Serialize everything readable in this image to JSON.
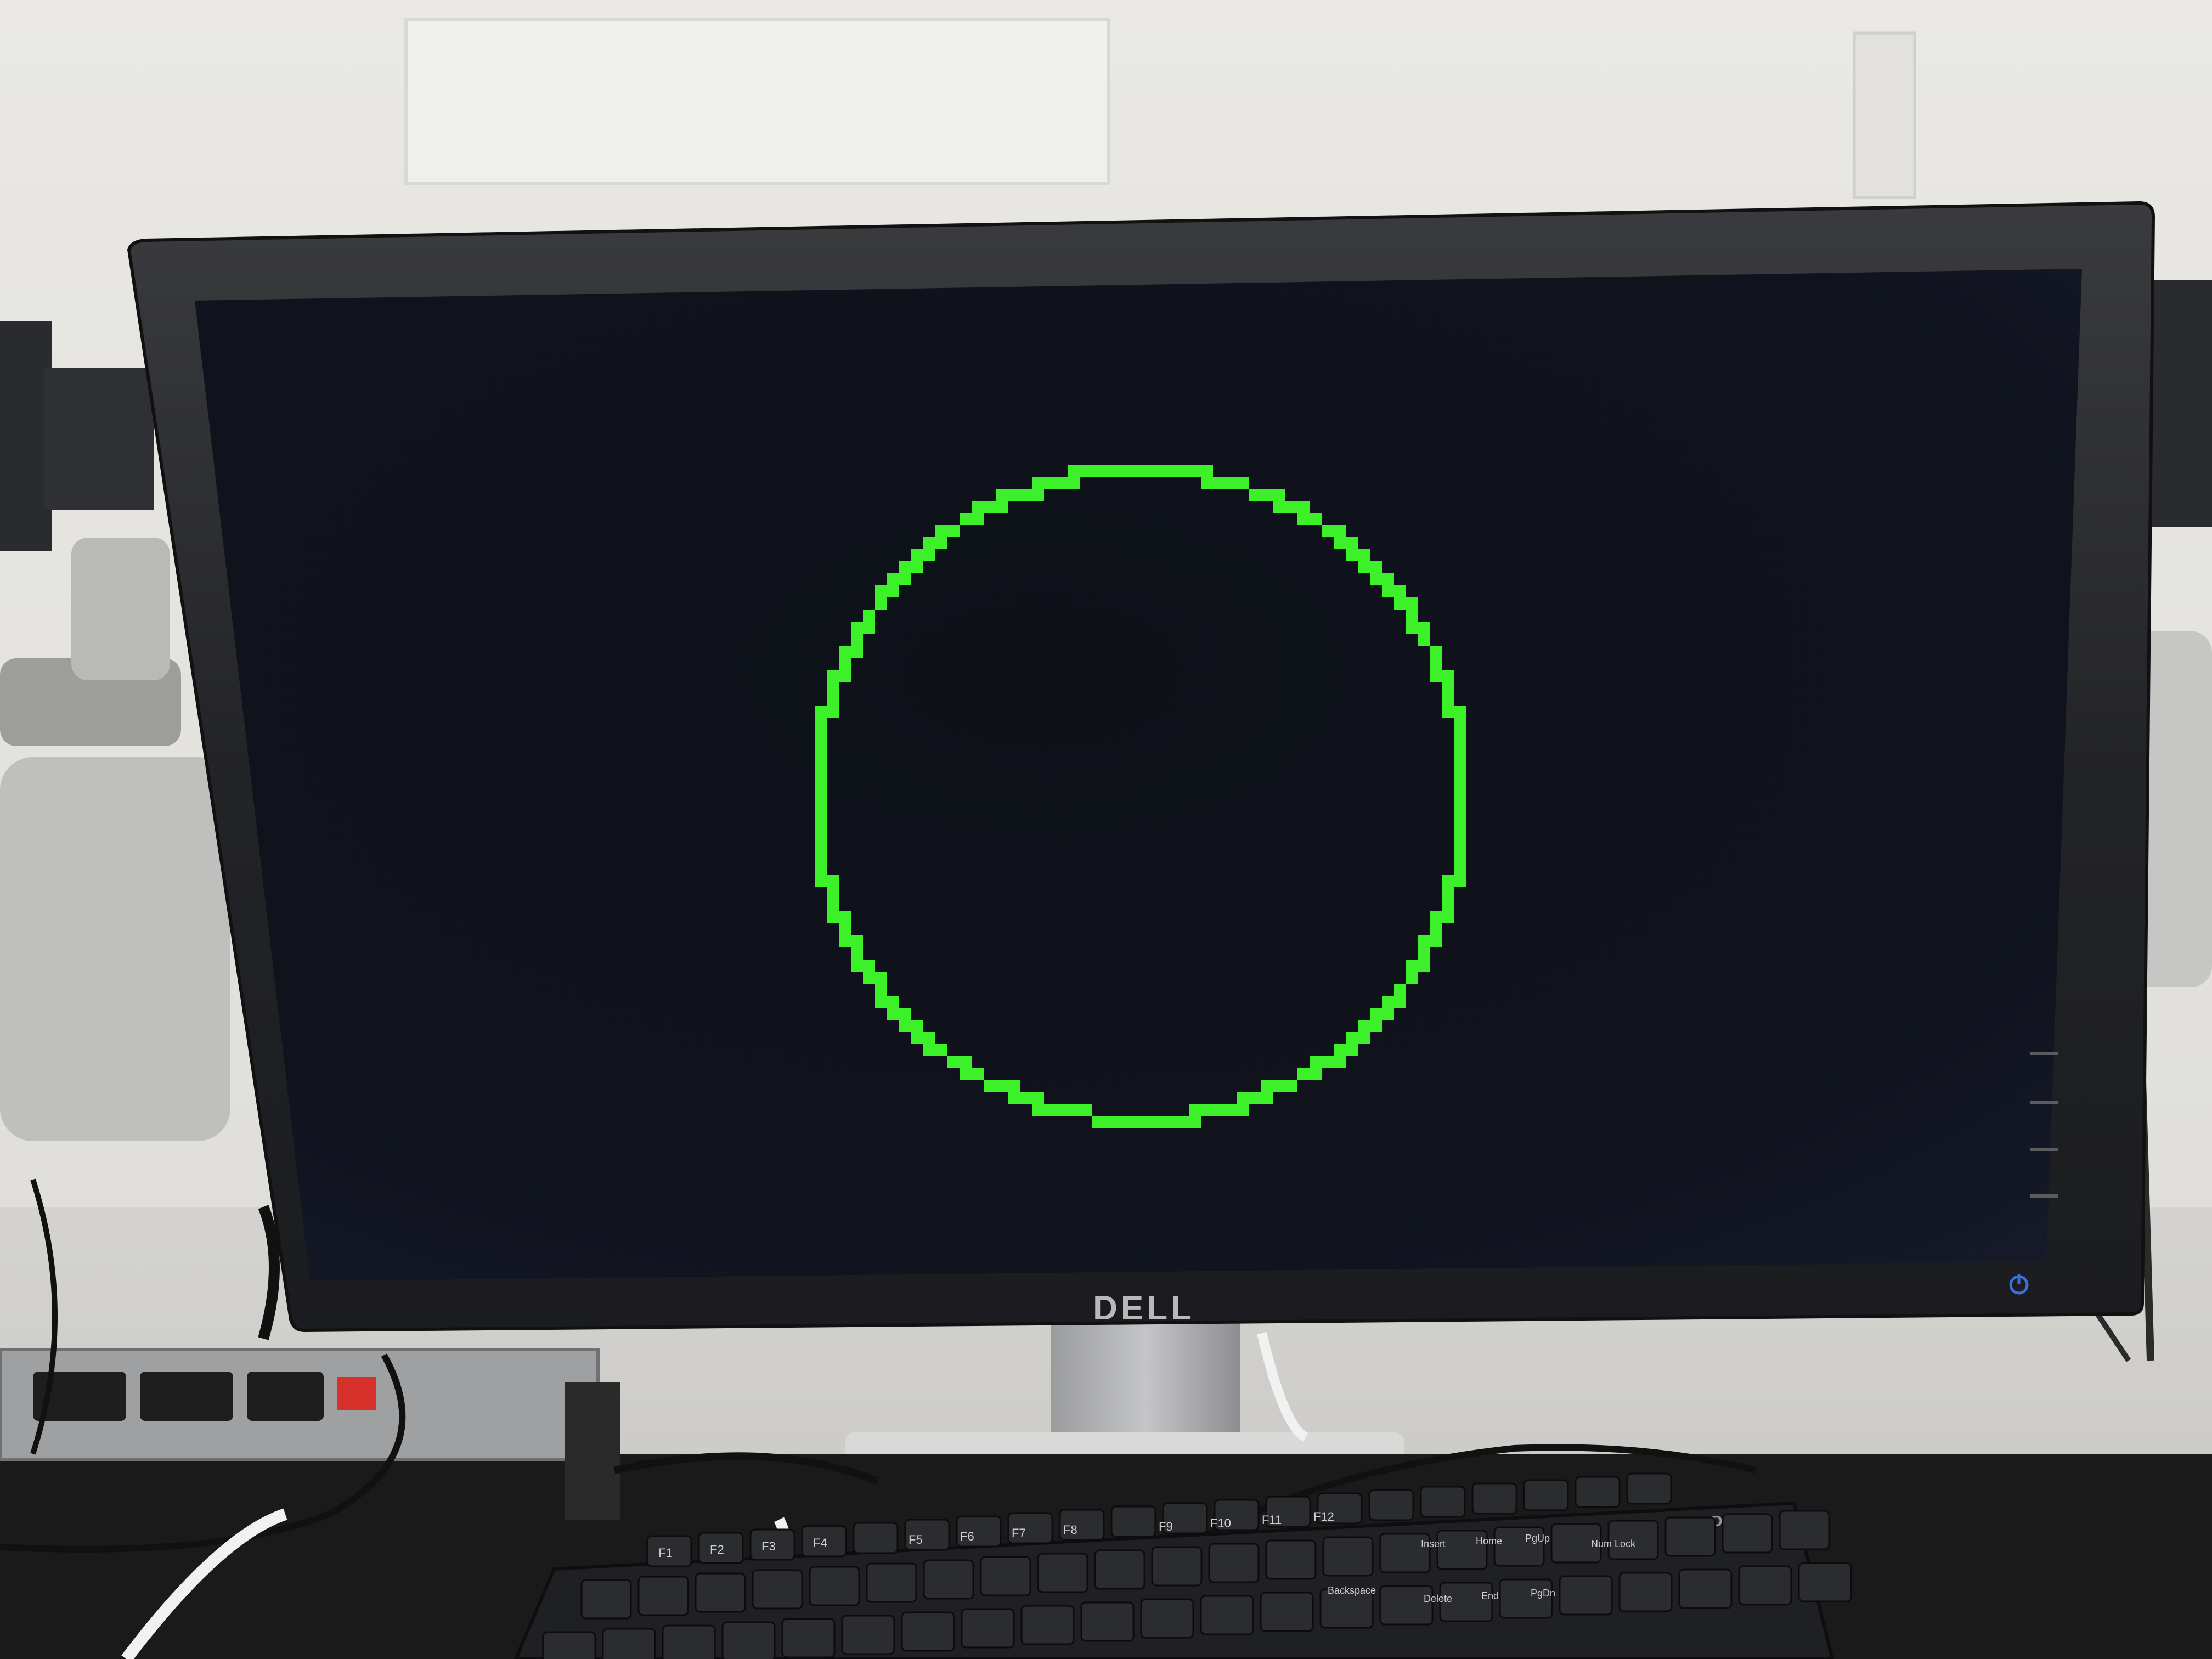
{
  "monitor": {
    "brand": "DELL"
  },
  "screen": {
    "background": "#0b0e14",
    "circle_color": "#3cf02a"
  },
  "keyboard": {
    "brand": "DELL",
    "function_keys": [
      "F1",
      "F2",
      "F3",
      "F4",
      "F5",
      "F6",
      "F7",
      "F8",
      "F9",
      "F10",
      "F11",
      "F12"
    ],
    "nav_labels": [
      "Insert",
      "Home",
      "PgUp",
      "Delete",
      "End",
      "PgDn",
      "Backspace",
      "Num Lock"
    ]
  }
}
